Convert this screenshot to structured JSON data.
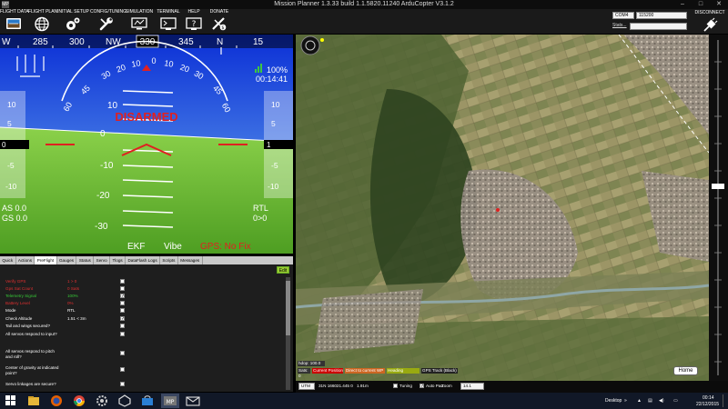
{
  "window": {
    "title": "Mission Planner 1.3.33 build 1.1.5820.11240 ArduCopter V3.1.2",
    "app_icon": "MP",
    "minimize": "–",
    "maximize": "□",
    "close": "✕"
  },
  "menu": {
    "items": [
      {
        "label": "FLIGHT DATA",
        "icon": "flight-data-icon"
      },
      {
        "label": "FLIGHT PLAN",
        "icon": "globe-icon"
      },
      {
        "label": "INITIAL SETUP",
        "icon": "gears-icon"
      },
      {
        "label": "CONFIG/TUNING",
        "icon": "wrench-icon"
      },
      {
        "label": "SIMULATION",
        "icon": "simulation-icon"
      },
      {
        "label": "TERMINAL",
        "icon": "terminal-icon"
      },
      {
        "label": "HELP",
        "icon": "help-icon"
      },
      {
        "label": "DONATE",
        "icon": "donate-icon"
      }
    ],
    "port": "COM4",
    "baud": "115200",
    "stats_link": "Stats...",
    "disconnect_label": "DISCONNECT"
  },
  "hud": {
    "heading_labels": [
      "W",
      "285",
      "300",
      "NW",
      "330",
      "345",
      "N",
      "15"
    ],
    "heading_value": "330",
    "roll_labels": [
      "60",
      "45",
      "30",
      "20",
      "10",
      "0",
      "10",
      "20",
      "30",
      "45",
      "60"
    ],
    "pitch_labels_above": [
      "10"
    ],
    "pitch_labels_below": [
      "-10",
      "-20",
      "-30"
    ],
    "pitch_zero": "0",
    "status_text": "DISARMED",
    "battery_pct": "100%",
    "flight_time": "00:14:41",
    "left_tape": [
      "10",
      "5",
      "0",
      "-5",
      "-10"
    ],
    "left_tape_current": "0",
    "right_tape": [
      "10",
      "5",
      "0",
      "-5",
      "-10"
    ],
    "right_tape_current": "1",
    "airspeed": "AS 0.0",
    "groundspeed": "GS 0.0",
    "mode": "RTL",
    "distance": "0>0",
    "ekf": "EKF",
    "vibe": "Vibe",
    "gps": "GPS: No Fix"
  },
  "tabs": [
    "Quick",
    "Actions",
    "PreFlight",
    "Gauges",
    "Status",
    "Servo",
    "Tlogs",
    "DataFlash Logs",
    "Scripts",
    "Messages"
  ],
  "tabs_active": "PreFlight",
  "checklist": {
    "edit_label": "Edit",
    "rows": [
      {
        "desc": "Verify GPS",
        "value": "1 > 0",
        "checked": "",
        "color": "red"
      },
      {
        "desc": "Gps Sat Count",
        "value": "0 Sats",
        "checked": "",
        "color": "red"
      },
      {
        "desc": "Telemetry Signal",
        "value": "100%",
        "checked": "✓",
        "color": "green"
      },
      {
        "desc": "Battery Level",
        "value": "0%",
        "checked": "",
        "color": "red"
      },
      {
        "desc": "Mode",
        "value": "RTL",
        "checked": "",
        "color": "white"
      },
      {
        "desc": "Check Altitude",
        "value": "1.51 < 3m",
        "checked": "✓",
        "color": "white"
      },
      {
        "desc": "Tail and wings secured?",
        "value": "",
        "checked": "",
        "color": "white"
      },
      {
        "desc": "All servos respond to input?",
        "value": "",
        "checked": "",
        "color": "white"
      },
      {
        "desc": "All servos respond to pitch and roll?",
        "value": "",
        "checked": "",
        "color": "white"
      },
      {
        "desc": "Center of gravity at indicated point?",
        "value": "",
        "checked": "",
        "color": "white"
      },
      {
        "desc": "Servo linkages are secure?",
        "value": "",
        "checked": "",
        "color": "white"
      }
    ]
  },
  "map": {
    "hdop": "hdop: 100.0",
    "sats": "Sats: 0",
    "legend_current": "Current Position",
    "legend_direct": "Direct to current WP",
    "legend_heading": "Heading",
    "legend_gps": "GPS Track (Black)",
    "home_label": "Home",
    "coord_system": "UTM",
    "coords": "31N 166021.445 0",
    "alt": "1.91m",
    "tuning_label": "Tuning",
    "autopan_label": "Auto Pan",
    "zoom_label": "Zoom",
    "zoom_value": "14.1",
    "autopan_checked": "✓"
  },
  "taskbar": {
    "desktop_label": "Desktop",
    "time": "00:14",
    "date": "22/12/2015"
  }
}
